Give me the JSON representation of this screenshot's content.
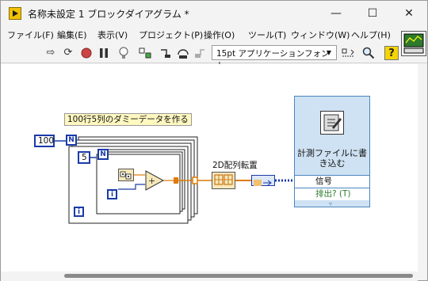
{
  "window": {
    "title": "名称未設定 1 ブロックダイアグラム *",
    "min_label": "—",
    "max_label": "☐",
    "close_label": "✕"
  },
  "menu": [
    {
      "label": "ファイル(F)"
    },
    {
      "label": "編集(E)"
    },
    {
      "label": "表示(V)"
    },
    {
      "label": "プロジェクト(P)"
    },
    {
      "label": "操作(O)"
    },
    {
      "label": "ツール(T)"
    },
    {
      "label": "ウィンドウ(W)"
    },
    {
      "label": "ヘルプ(H)"
    }
  ],
  "toolbar": {
    "font_select": "15pt アプリケーションフォント",
    "help_label": "?"
  },
  "diagram": {
    "comment": "100行5列のダミーデータを作る",
    "outer_count": "100",
    "inner_count": "5",
    "n_label": "N",
    "i_label": "i",
    "transpose_label": "2D配列転置",
    "express_title": "計測ファイルに書き込む",
    "express_signal": "信号",
    "express_extract": "排出? (T)"
  },
  "colors": {
    "wire_orange": "#e07a00",
    "int_blue": "#1a3aa8",
    "express_bg": "#cfe2f3"
  }
}
